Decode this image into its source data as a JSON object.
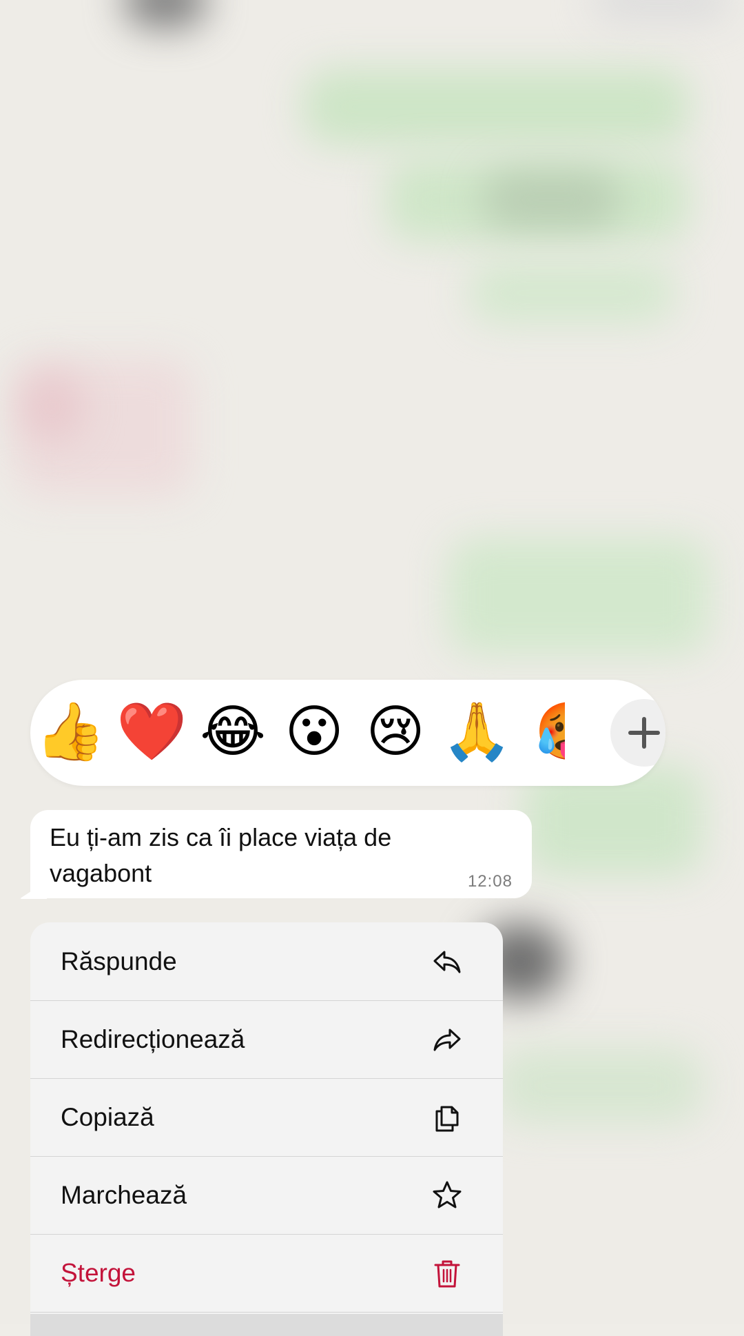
{
  "reactions": {
    "emojis": [
      {
        "char": "👍",
        "name": "thumbs-up"
      },
      {
        "char": "❤️",
        "name": "heart"
      },
      {
        "char": "😂",
        "name": "laughing-tears"
      },
      {
        "char": "😮",
        "name": "surprised"
      },
      {
        "char": "😢",
        "name": "crying"
      },
      {
        "char": "🙏",
        "name": "praying-hands"
      },
      {
        "char": "🥵",
        "name": "hot-face"
      }
    ],
    "more_icon": "plus-icon"
  },
  "message": {
    "text": "Eu ți-am zis ca îi place viața de vagabont",
    "time": "12:08"
  },
  "menu": {
    "items": [
      {
        "label": "Răspunde",
        "icon": "reply-icon"
      },
      {
        "label": "Redirecționează",
        "icon": "forward-icon"
      },
      {
        "label": "Copiază",
        "icon": "copy-icon"
      },
      {
        "label": "Marchează",
        "icon": "star-icon"
      },
      {
        "label": "Șterge",
        "icon": "trash-icon"
      }
    ]
  },
  "colors": {
    "danger": "#c3133a",
    "menu_bg": "#f3f3f3",
    "bubble_bg": "#ffffff"
  }
}
